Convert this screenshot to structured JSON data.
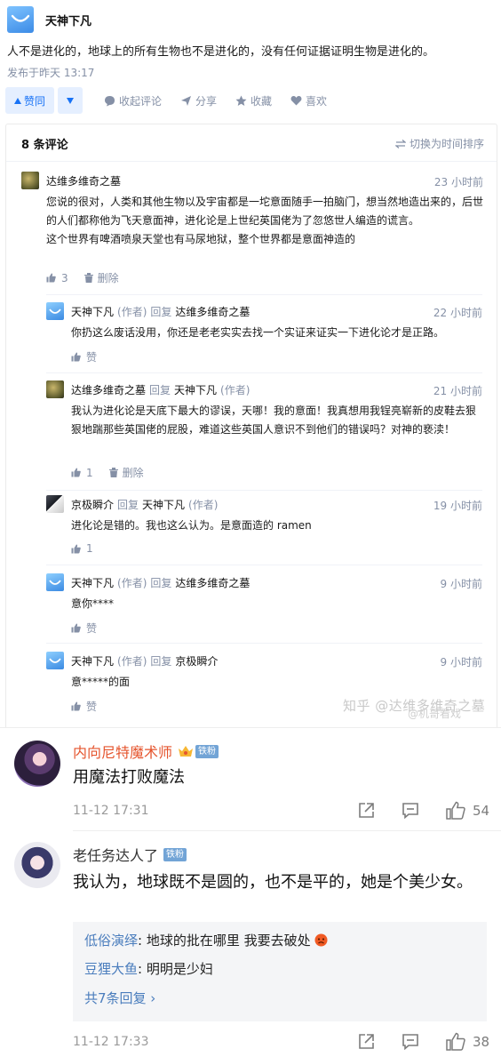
{
  "answer": {
    "author": "天神下凡",
    "text": "人不是进化的，地球上的所有生物也不是进化的，没有任何证据证明生物是进化的。",
    "published": "发布于昨天 13:17"
  },
  "actions": {
    "upvote": "赞同",
    "collapse": "收起评论",
    "share": "分享",
    "favorite": "收藏",
    "like": "喜欢"
  },
  "comments_header": {
    "count": "8 条评论",
    "sort": "切换为时间排序"
  },
  "comments": [
    {
      "author": "达维多维奇之墓",
      "time": "23 小时前",
      "body": "您说的很对，人类和其他生物以及宇宙都是一坨意面随手一拍脑门，想当然地造出来的，后世的人们都称他为飞天意面神，进化论是上世纪英国佬为了忽悠世人编造的谎言。",
      "body2": "这个世界有啤酒喷泉天堂也有马尿地狱，整个世界都是意面神造的",
      "likes": "3",
      "delete": "删除"
    },
    {
      "author": "天神下凡",
      "author_tag": "(作者)",
      "reply_word": "回复",
      "reply_to": "达维多维奇之墓",
      "time": "22 小时前",
      "body": "你扔这么废话没用，你还是老老实实去找一个实证来证实一下进化论才是正路。",
      "likes": "赞"
    },
    {
      "author": "达维多维奇之墓",
      "reply_word": "回复",
      "reply_to": "天神下凡",
      "reply_to_tag": "(作者)",
      "time": "21 小时前",
      "body": "我认为进化论是天底下最大的谬误，天哪！我的意面！我真想用我锃亮崭新的皮鞋去狠狠地踹那些英国佬的屁股，难道这些英国人意识不到他们的错误吗？对神的亵渎！",
      "likes": "1",
      "delete": "删除"
    },
    {
      "author": "京极瞬介",
      "reply_word": "回复",
      "reply_to": "天神下凡",
      "reply_to_tag": "(作者)",
      "time": "19 小时前",
      "body": "进化论是错的。我也这么认为。是意面造的 ramen",
      "likes": "1"
    },
    {
      "author": "天神下凡",
      "author_tag": "(作者)",
      "reply_word": "回复",
      "reply_to": "达维多维奇之墓",
      "time": "9 小时前",
      "body": "意你****",
      "likes": "赞"
    },
    {
      "author": "天神下凡",
      "author_tag": "(作者)",
      "reply_word": "回复",
      "reply_to": "京极瞬介",
      "time": "9 小时前",
      "body": "意*****的面",
      "likes": "赞"
    }
  ],
  "watermark": "知乎 @达维多维奇之墓",
  "watermark2": "@机哥看戏",
  "weibo": [
    {
      "name": "内向尼特魔术师",
      "badge": "铁粉",
      "text": "用魔法打败魔法",
      "time": "11-12 17:31",
      "likes": "54"
    },
    {
      "name": "老任务达人了",
      "badge": "铁粉",
      "text": "我认为，地球既不是圆的，也不是平的，她是个美少女。",
      "time": "11-12 17:33",
      "likes": "38",
      "replies": [
        {
          "name": "低俗演绎",
          "text": ": 地球的批在哪里 我要去破处"
        },
        {
          "name": "豆狸大鱼",
          "text": ": 明明是少妇"
        }
      ],
      "more": "共7条回复 ›"
    }
  ]
}
